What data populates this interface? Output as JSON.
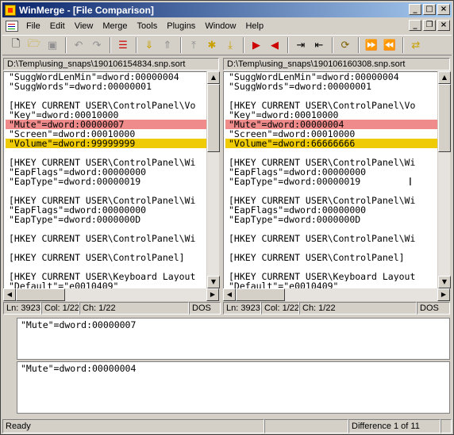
{
  "window": {
    "title": "WinMerge - [File Comparison]"
  },
  "menu": [
    "File",
    "Edit",
    "View",
    "Merge",
    "Tools",
    "Plugins",
    "Window",
    "Help"
  ],
  "toolbar": {
    "icons": [
      "new-icon",
      "open-icon",
      "save-icon",
      "undo-icon",
      "redo-icon",
      "options-icon",
      "next-diff-icon",
      "prev-diff-icon",
      "first-diff-icon",
      "current-diff-icon",
      "last-diff-icon",
      "copy-right-icon",
      "copy-left-icon",
      "copy-right-advance-icon",
      "copy-left-advance-icon",
      "all-right-icon",
      "all-left-icon",
      "refresh-icon"
    ]
  },
  "left": {
    "path": "D:\\Temp\\using_snaps\\190106154834.snp.sort",
    "lines": [
      "\"SuggWordLenMin\"=dword:00000004",
      "\"SuggWords\"=dword:00000001",
      "",
      "[HKEY_CURRENT_USER\\ControlPanel\\Vo",
      "\"Key\"=dword:00010000",
      "\"Mute\"=dword:00000007",
      "\"Screen\"=dword:00010000",
      "\"Volume\"=dword:99999999",
      "",
      "[HKEY_CURRENT_USER\\ControlPanel\\Wi",
      "\"EapFlags\"=dword:00000000",
      "\"EapType\"=dword:00000019",
      "",
      "[HKEY_CURRENT_USER\\ControlPanel\\Wi",
      "\"EapFlags\"=dword:00000000",
      "\"EapType\"=dword:0000000D",
      "",
      "[HKEY_CURRENT_USER\\ControlPanel\\Wi",
      "",
      "[HKEY_CURRENT_USER\\ControlPanel]",
      "",
      "[HKEY_CURRENT_USER\\Keyboard Layout",
      "\"Default\"=\"e0010409\""
    ],
    "status": {
      "ln": "Ln: 3923",
      "col": "Col: 1/22",
      "ch": "Ch: 1/22",
      "eol": "DOS"
    }
  },
  "right": {
    "path": "D:\\Temp\\using_snaps\\190106160308.snp.sort",
    "lines": [
      "\"SuggWordLenMin\"=dword:00000004",
      "\"SuggWords\"=dword:00000001",
      "",
      "[HKEY_CURRENT_USER\\ControlPanel\\Vo",
      "\"Key\"=dword:00010000",
      "\"Mute\"=dword:00000004",
      "\"Screen\"=dword:00010000",
      "\"Volume\"=dword:66666666",
      "",
      "[HKEY_CURRENT_USER\\ControlPanel\\Wi",
      "\"EapFlags\"=dword:00000000",
      "\"EapType\"=dword:00000019",
      "",
      "[HKEY_CURRENT_USER\\ControlPanel\\Wi",
      "\"EapFlags\"=dword:00000000",
      "\"EapType\"=dword:0000000D",
      "",
      "[HKEY_CURRENT_USER\\ControlPanel\\Wi",
      "",
      "[HKEY_CURRENT_USER\\ControlPanel]",
      "",
      "[HKEY_CURRENT_USER\\Keyboard Layout",
      "\"Default\"=\"e0010409\""
    ],
    "status": {
      "ln": "Ln: 3923",
      "col": "Col: 1/22",
      "ch": "Ch: 1/22",
      "eol": "DOS"
    }
  },
  "colors": {
    "selected_diff": "#ef8b8b",
    "diff": "#efcb05",
    "title_start": "#0a246a",
    "title_end": "#a6caf0"
  },
  "detail": {
    "top": "\"Mute\"=dword:00000007",
    "bottom": "\"Mute\"=dword:00000004"
  },
  "statusbar": {
    "ready": "Ready",
    "difference": "Difference 1 of 11"
  }
}
